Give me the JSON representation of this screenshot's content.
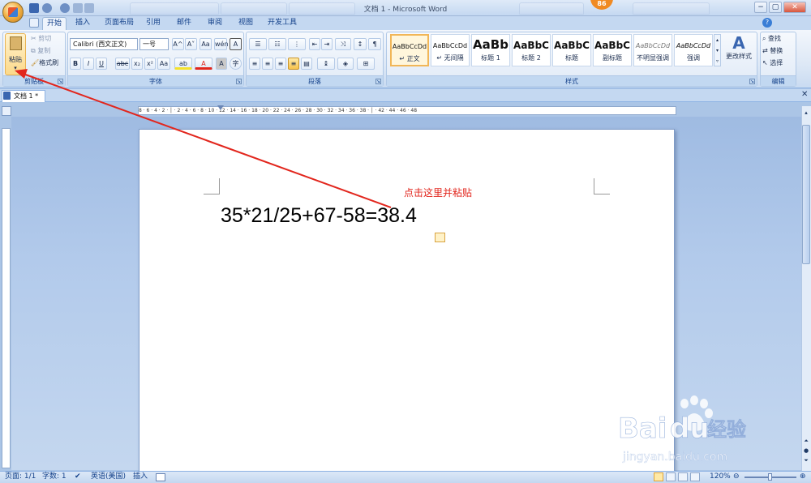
{
  "window": {
    "title": "文档 1 - Microsoft Word",
    "notification_count": "86",
    "controls": {
      "minimize": "−",
      "maximize": "▢",
      "close": "✕"
    }
  },
  "ribbon_tabs": [
    "开始",
    "插入",
    "页面布局",
    "引用",
    "邮件",
    "审阅",
    "视图",
    "开发工具"
  ],
  "active_tab": "开始",
  "clipboard": {
    "paste": "粘贴",
    "cut": "剪切",
    "copy": "复制",
    "format_painter": "格式刷",
    "group_label": "剪贴板"
  },
  "font": {
    "name": "Calibri (西文正文)",
    "size": "一号",
    "grow": "A^",
    "shrink": "A˅",
    "clear": "Aa",
    "phonetic": "wén",
    "border_char": "A",
    "bold": "B",
    "italic": "I",
    "underline": "U",
    "strike": "abc",
    "subscript": "x₂",
    "superscript": "x²",
    "change_case": "Aa",
    "highlight": "ab",
    "font_color": "A",
    "char_shading": "A",
    "enclose": "字",
    "group_label": "字体"
  },
  "paragraph": {
    "group_label": "段落"
  },
  "styles": {
    "items": [
      {
        "sample": "AaBbCcDd",
        "name": "↵ 正文"
      },
      {
        "sample": "AaBbCcDd",
        "name": "↵ 无间隔"
      },
      {
        "sample": "AaBb",
        "name": "标题 1"
      },
      {
        "sample": "AaBbC",
        "name": "标题 2"
      },
      {
        "sample": "AaBbC",
        "name": "标题"
      },
      {
        "sample": "AaBbC",
        "name": "副标题"
      },
      {
        "sample": "AaBbCcDd",
        "name": "不明显强调"
      },
      {
        "sample": "AaBbCcDd",
        "name": "强调"
      }
    ],
    "selected_index": 0,
    "change_styles": "更改样式",
    "group_label": "样式"
  },
  "editing": {
    "find": "查找",
    "replace": "替换",
    "select": "选择",
    "group_label": "编辑"
  },
  "document": {
    "tab_name": "文档 1 *",
    "content": "35*21/25+67-58=38.4",
    "annotation": "点击这里并粘贴"
  },
  "horizontal_ruler": "8 · 6 · 4 · 2 · │ · 2 · 4 · 6 · 8 · 10 · 12 · 14 · 16 · 18 · 20 · 22 · 24 · 26 · 28 · 30 · 32 · 34 · 36 · 38 · │ · 42 · 44 · 46 · 48",
  "status_bar": {
    "page": "页面: 1/1",
    "word_count": "字数: 1",
    "language": "英语(美国)",
    "mode": "插入",
    "zoom": "120%"
  },
  "watermark": {
    "brand": "Baidu经验",
    "url": "jingyan.baidu.com"
  },
  "colors": {
    "annotation": "#e2261d",
    "arrow": "#e2261d",
    "ribbon_blue": "#c4d8f1",
    "selected_style": "#f1b658"
  }
}
